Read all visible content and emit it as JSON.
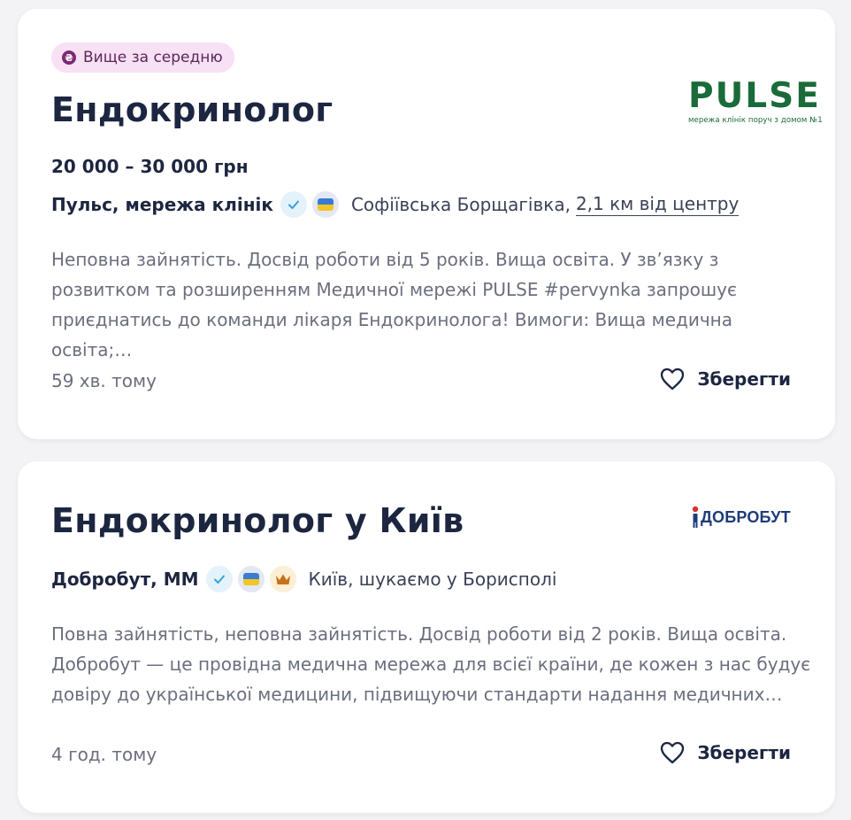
{
  "cards": [
    {
      "badge": "Вище за середню",
      "badge_icon": "hryvnia-icon",
      "title": "Ендокринолог",
      "salary": "20 000 – 30 000 грн",
      "company": "Пульс, мережа клінік",
      "location": "Софіївська Борщагівка,",
      "distance": "2,1 км від центру",
      "description": "Неповна зайнятість. Досвід роботи від 5 років. Вища освіта. У зв’язку з розвитком та розширенням Медичної мережі PULSE #pervynka запрошує приєднатись до команди лікаря Ендокринолога! Вимоги: Вища медична освіта;…",
      "posted": "59 хв. тому",
      "save_label": "Зберегти",
      "logo": {
        "word": "PULSE",
        "tagline": "мережа клінік поруч з домом №1",
        "color": "#1a6b3a"
      }
    },
    {
      "title": "Ендокринолог у Київ",
      "company": "Добробут, ММ",
      "location": "Київ, шукаємо у Борисполі",
      "description": "Повна зайнятість, неповна зайнятість. Досвід роботи від 2 років. Вища освіта. Добробут — це провідна медична мережа для всієї країни, де кожен з нас будує довіру до української медицини, підвищуючи стандарти надання медичних…",
      "posted": "4 год. тому",
      "save_label": "Зберегти",
      "logo": {
        "word": "ДОБРОБУТ",
        "color": "#1d3c7a"
      }
    }
  ],
  "colors": {
    "badge_bg": "#f8e0f5",
    "verify_check": "#3aa0d8",
    "flag_blue": "#3a7bd5",
    "flag_yellow": "#f2c624",
    "crown": "#c8701a",
    "title_text": "#1d2640",
    "muted_text": "#6b6f7e"
  }
}
